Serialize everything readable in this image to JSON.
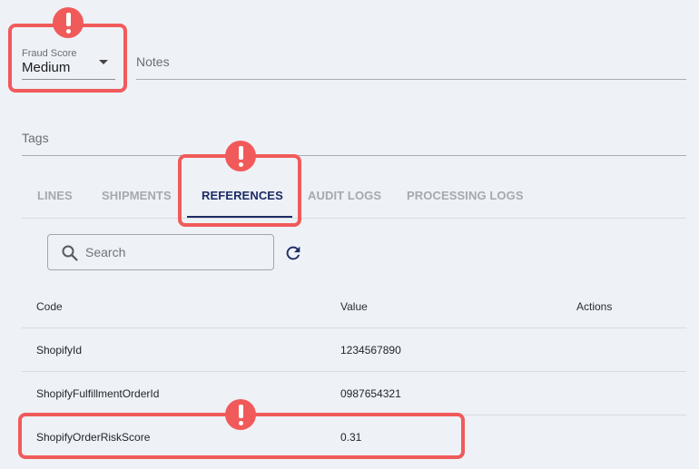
{
  "form": {
    "fraud_score": {
      "label": "Fraud Score",
      "value": "Medium"
    },
    "notes_label": "Notes",
    "tags_label": "Tags"
  },
  "tabs": [
    {
      "label": "LINES",
      "active": false
    },
    {
      "label": "SHIPMENTS",
      "active": false
    },
    {
      "label": "REFERENCES",
      "active": true
    },
    {
      "label": "AUDIT LOGS",
      "active": false
    },
    {
      "label": "PROCESSING LOGS",
      "active": false
    }
  ],
  "search": {
    "placeholder": "Search"
  },
  "table": {
    "headers": {
      "code": "Code",
      "value": "Value",
      "actions": "Actions"
    },
    "rows": [
      {
        "code": "ShopifyId",
        "value": "1234567890"
      },
      {
        "code": "ShopifyFulfillmentOrderId",
        "value": "0987654321"
      },
      {
        "code": "ShopifyOrderRiskScore",
        "value": "0.31"
      }
    ]
  },
  "colors": {
    "accent": "#1d2c63",
    "highlight": "#f15a5a",
    "background": "#eef1f6"
  },
  "icons": [
    "search-icon",
    "refresh-icon",
    "chevron-down-icon",
    "alert-icon"
  ]
}
